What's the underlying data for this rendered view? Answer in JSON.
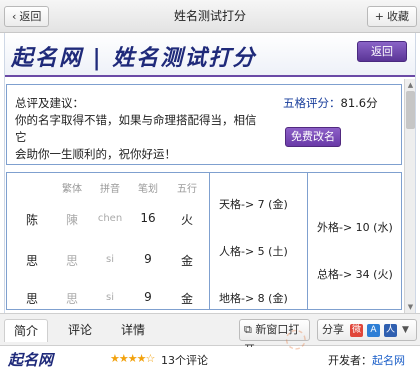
{
  "nav": {
    "back_label": "返回",
    "title": "姓名测试打分",
    "favorite_label": "收藏"
  },
  "header": {
    "logo_text": "起名网 | 姓名测试打分",
    "return_label": "返回"
  },
  "summary": {
    "line1": "总评及建议：",
    "line2": "你的名字取得不错，如果与命理搭配得当，相信它",
    "line3": "会助你一生顺利的，祝你好运！",
    "score_label": "五格评分：",
    "score_value": "81.6分",
    "rename_label": "免费改名"
  },
  "table": {
    "headers": [
      "繁体",
      "拼音",
      "笔划",
      "五行"
    ],
    "rows": [
      {
        "char": "陈",
        "trad": "陳",
        "pinyin": "chen",
        "strokes": "16",
        "element": "火"
      },
      {
        "char": "思",
        "trad": "思",
        "pinyin": "si",
        "strokes": "9",
        "element": "金"
      },
      {
        "char": "思",
        "trad": "思",
        "pinyin": "si",
        "strokes": "9",
        "element": "金"
      }
    ],
    "ge_left": [
      "天格-> 7 (金)",
      "人格-> 5 (土)",
      "地格-> 8 (金)"
    ],
    "ge_right": [
      "外格-> 10 (水)",
      "总格-> 34 (火)"
    ]
  },
  "tabs": [
    "简介",
    "评论",
    "详情"
  ],
  "actions": {
    "new_window_label": "新窗口打开",
    "share_label": "分享"
  },
  "footer": {
    "logo_text": "起名网",
    "review_count": "13个评论",
    "developer_label": "开发者：",
    "developer_name": "起名网"
  },
  "colors": {
    "accent_purple": "#6a3aa8",
    "border_blue": "#7fa0cf",
    "score_blue": "#1a3f9c"
  },
  "icons": {
    "back": "chevron-left-icon",
    "favorite": "plus-icon",
    "new_window": "new-window-icon",
    "share": [
      "weibo-icon",
      "a-icon",
      "ren-icon",
      "chevron-down-icon"
    ]
  }
}
